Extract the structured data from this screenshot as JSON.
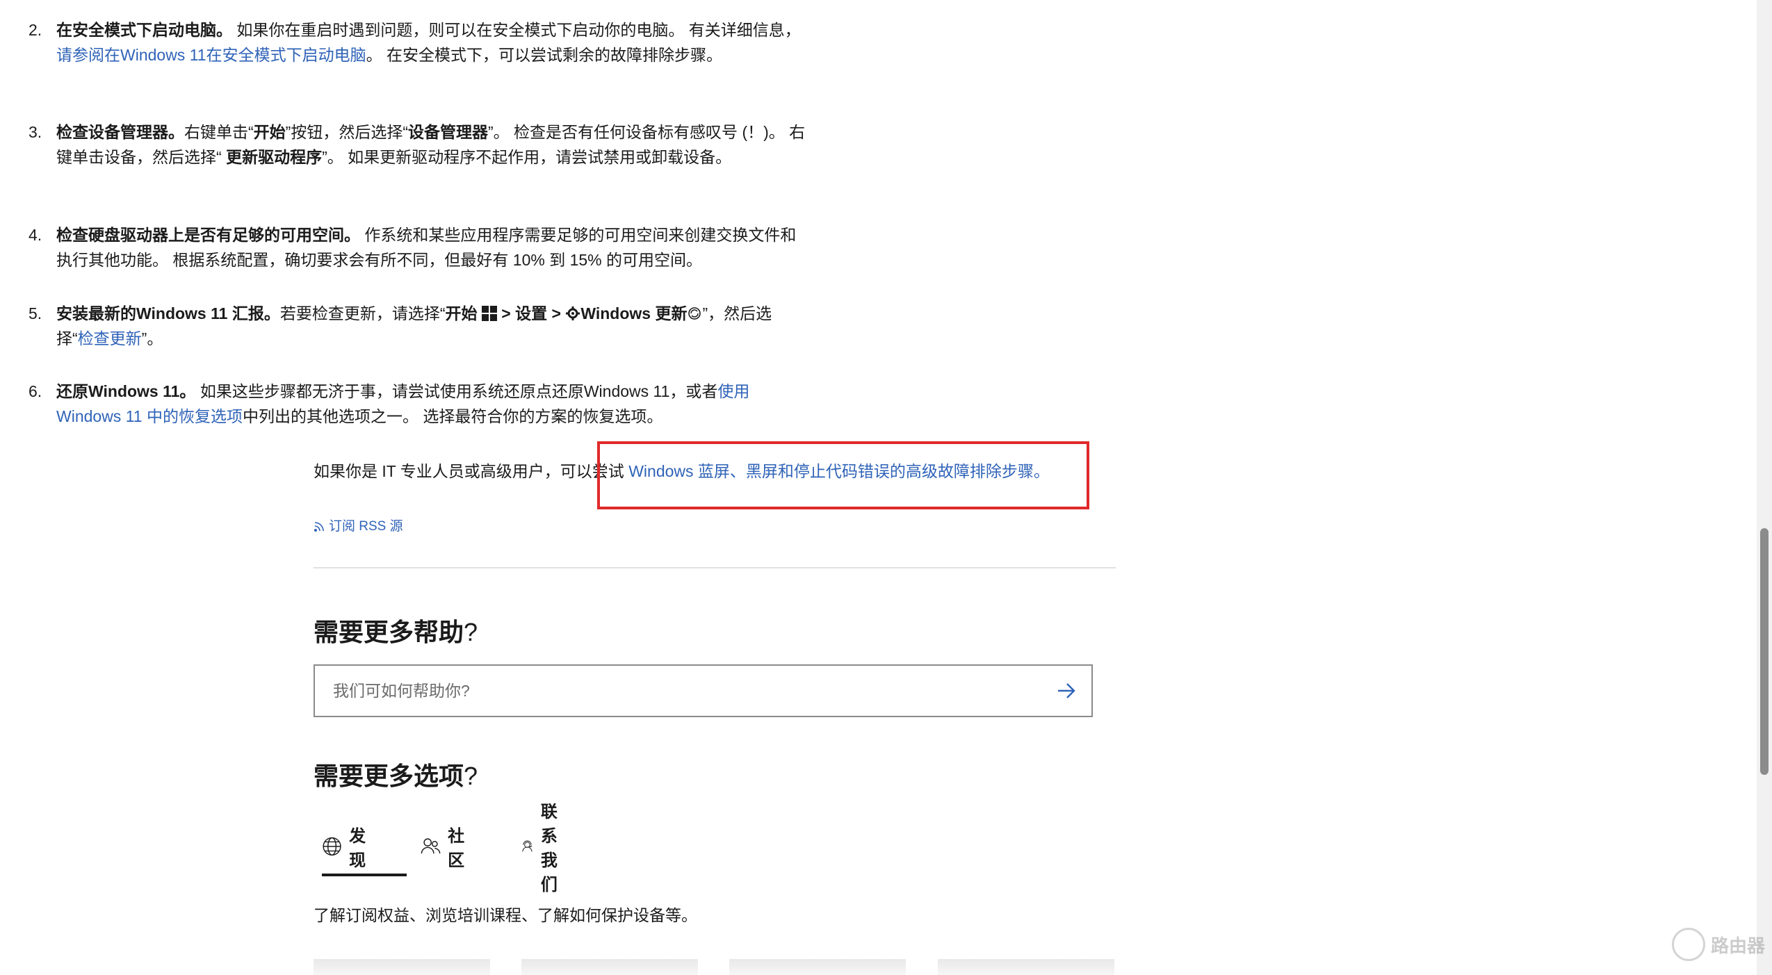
{
  "steps": [
    {
      "num": "2.",
      "bold": "在安全模式下启动电脑。",
      "text1": " 如果你在重启时遇到问题，则可以在安全模式下启动你的电脑。 有关详细信息，",
      "link": "请参阅在Windows 11在安全模式下启动电脑",
      "text2": "。 在安全模式下，可以尝试剩余的故障排除步骤。"
    },
    {
      "num": "3.",
      "bold": "检查设备管理器。",
      "text1": "右键单击“",
      "bold2": "开始",
      "text2": "”按钮，然后选择“",
      "bold3": "设备管理器",
      "text3": "”。 检查是否有任何设备标有感叹号 (！)。 右键单击设备，然后选择“ ",
      "bold4": "更新驱动程序",
      "text4": "”。 如果更新驱动程序不起作用，请尝试禁用或卸载设备。"
    },
    {
      "num": "4.",
      "bold": "检查硬盘驱动器上是否有足够的可用空间。",
      "text1": " 作系统和某些应用程序需要足够的可用空间来创建交换文件和执行其他功能。 根据系统配置，确切要求会有所不同，但最好有 10% 到 15% 的可用空间。"
    },
    {
      "num": "5.",
      "bold": "安装最新的Windows 11 汇报。",
      "text1": "若要检查更新，请选择“",
      "bold2": "开始",
      "sep1": " > ",
      "bold3": "设置",
      "sep2": " > ",
      "bold4": "Windows 更新",
      "text2": "”，然后选择“",
      "link": "检查更新",
      "text3": "”。"
    },
    {
      "num": "6.",
      "bold": "还原Windows 11。",
      "text1": " 如果这些步骤都无济于事，请尝试使用系统还原点还原Windows 11，或者",
      "link": "使用 Windows 11 中的恢复选项",
      "text2": "中列出的其他选项之一。 选择最符合你的方案的恢复选项。"
    }
  ],
  "it_para": {
    "text": "如果你是 IT 专业人员或高级用户，可以尝试 ",
    "link": "Windows 蓝屏、黑屏和停止代码错误的高级故障排除步骤",
    "end": "。"
  },
  "rss": "订阅 RSS 源",
  "help": {
    "title": "需要更多帮助",
    "q": "?",
    "placeholder": "我们可如何帮助你?"
  },
  "options": {
    "title": "需要更多选项",
    "q": "?",
    "tabs": [
      {
        "label": "发现",
        "icon": "globe-icon"
      },
      {
        "label": "社区",
        "icon": "people-icon"
      },
      {
        "label": "联系我们",
        "icon": "headset-icon"
      }
    ],
    "desc": "了解订阅权益、浏览培训课程、了解如何保护设备等。"
  },
  "watermark": "路由器",
  "colors": {
    "link": "#2f63b8",
    "highlight": "#e02a2a"
  }
}
